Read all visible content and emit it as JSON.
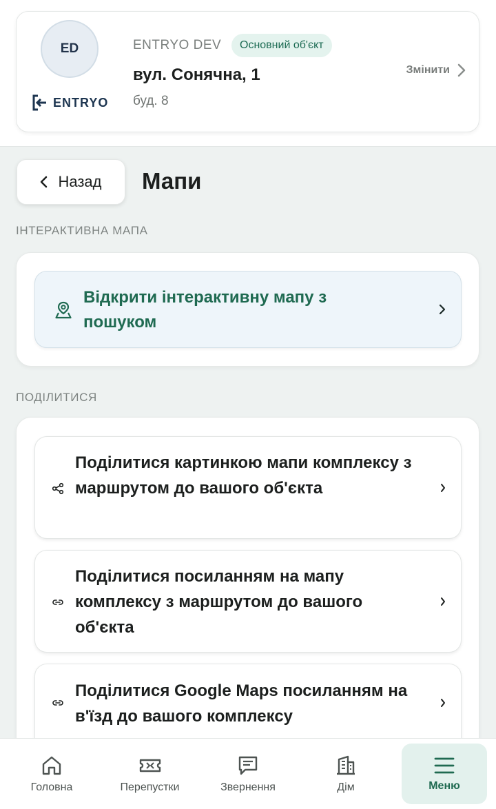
{
  "org": {
    "avatar_initials": "ED",
    "brand": "ENTRYO",
    "name": "ENTRYO DEV",
    "badge": "Основний об'єкт",
    "street": "вул. Сонячна, 1",
    "building": "буд. 8",
    "change_label": "Змінити"
  },
  "page": {
    "back_label": "Назад",
    "title": "Мапи"
  },
  "interactive_section": {
    "label": "ІНТЕРАКТИВНА МАПА",
    "open_button": "Відкрити інтерактивну мапу з пошуком"
  },
  "share_section": {
    "label": "ПОДІЛИТИСЯ",
    "items": [
      {
        "label": "Поділитися картинкою мапи комплексу з маршрутом до вашого об'єкта",
        "icon": "share-icon"
      },
      {
        "label": "Поділитися посиланням на мапу комплексу з маршрутом до вашого об'єкта",
        "icon": "link-icon"
      },
      {
        "label": "Поділитися Google Maps посиланням на в'їзд до вашого комплексу",
        "icon": "link-icon"
      }
    ]
  },
  "bottom_nav": {
    "items": [
      {
        "label": "Головна",
        "icon": "home-icon"
      },
      {
        "label": "Перепустки",
        "icon": "ticket-icon"
      },
      {
        "label": "Звернення",
        "icon": "message-icon"
      },
      {
        "label": "Дім",
        "icon": "building-icon"
      },
      {
        "label": "Меню",
        "icon": "menu-icon",
        "active": true
      }
    ]
  },
  "colors": {
    "accent": "#1f6a51",
    "badge_bg": "#e4f3ee",
    "page_bg": "#eef2f1",
    "map_button_bg": "#eef5fa"
  }
}
